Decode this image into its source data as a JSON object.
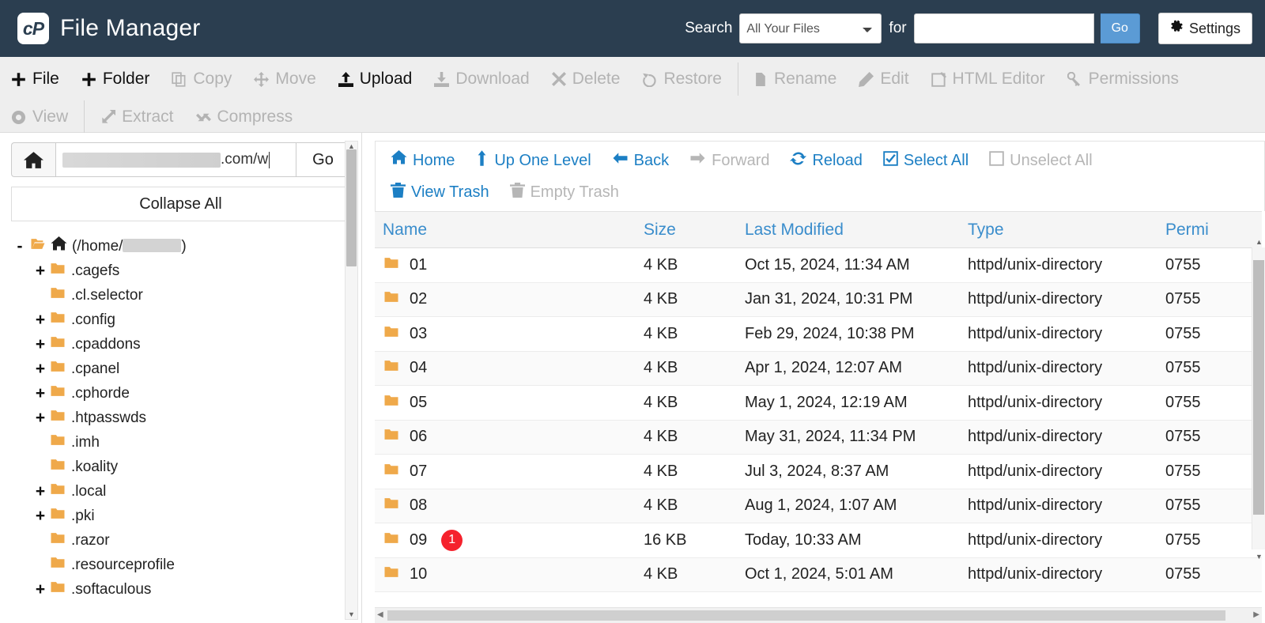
{
  "header": {
    "logo_text": "cP",
    "title": "File Manager",
    "search_label": "Search",
    "search_scope_selected": "All Your Files",
    "search_scope_options": [
      "All Your Files"
    ],
    "for_label": "for",
    "search_value": "",
    "search_placeholder": "",
    "go_label": "Go",
    "settings_label": "Settings",
    "bg_color": "#2b3e50",
    "go_button_color": "#5b9bd5"
  },
  "toolbar": {
    "row1": [
      {
        "label": "File",
        "icon": "plus-icon",
        "disabled": false
      },
      {
        "label": "Folder",
        "icon": "plus-icon",
        "disabled": false
      },
      {
        "label": "Copy",
        "icon": "copy-icon",
        "disabled": true
      },
      {
        "label": "Move",
        "icon": "move-icon",
        "disabled": true
      },
      {
        "label": "Upload",
        "icon": "upload-icon",
        "disabled": false
      },
      {
        "label": "Download",
        "icon": "download-icon",
        "disabled": true
      },
      {
        "label": "Delete",
        "icon": "x-icon",
        "disabled": true
      },
      {
        "label": "Restore",
        "icon": "restore-icon",
        "disabled": true
      },
      {
        "label": "Rename",
        "icon": "file-icon",
        "disabled": true
      },
      {
        "label": "Edit",
        "icon": "pencil-icon",
        "disabled": true
      },
      {
        "label": "HTML Editor",
        "icon": "html-editor-icon",
        "disabled": true
      },
      {
        "label": "Permissions",
        "icon": "key-icon",
        "disabled": true
      }
    ],
    "row2": [
      {
        "label": "View",
        "icon": "eye-icon",
        "disabled": true
      },
      {
        "label": "Extract",
        "icon": "extract-icon",
        "disabled": true
      },
      {
        "label": "Compress",
        "icon": "compress-icon",
        "disabled": true
      }
    ]
  },
  "sidebar": {
    "home_icon": "home-icon",
    "path_value_visible": ".com/w",
    "path_redacted": true,
    "path_go_label": "Go",
    "collapse_all_label": "Collapse All",
    "tree": [
      {
        "toggle": "-",
        "label": "(/home/",
        "label_suffix": ")",
        "redacted": true,
        "icon": "open-folder-home-icon",
        "depth": 0
      },
      {
        "toggle": "+",
        "label": ".cagefs",
        "icon": "folder-icon",
        "depth": 1
      },
      {
        "toggle": "",
        "label": ".cl.selector",
        "icon": "folder-icon",
        "depth": 1
      },
      {
        "toggle": "+",
        "label": ".config",
        "icon": "folder-icon",
        "depth": 1
      },
      {
        "toggle": "+",
        "label": ".cpaddons",
        "icon": "folder-icon",
        "depth": 1
      },
      {
        "toggle": "+",
        "label": ".cpanel",
        "icon": "folder-icon",
        "depth": 1
      },
      {
        "toggle": "+",
        "label": ".cphorde",
        "icon": "folder-icon",
        "depth": 1
      },
      {
        "toggle": "+",
        "label": ".htpasswds",
        "icon": "folder-icon",
        "depth": 1
      },
      {
        "toggle": "",
        "label": ".imh",
        "icon": "folder-icon",
        "depth": 1
      },
      {
        "toggle": "",
        "label": ".koality",
        "icon": "folder-icon",
        "depth": 1
      },
      {
        "toggle": "+",
        "label": ".local",
        "icon": "folder-icon",
        "depth": 1
      },
      {
        "toggle": "+",
        "label": ".pki",
        "icon": "folder-icon",
        "depth": 1
      },
      {
        "toggle": "",
        "label": ".razor",
        "icon": "folder-icon",
        "depth": 1
      },
      {
        "toggle": "",
        "label": ".resourceprofile",
        "icon": "folder-icon",
        "depth": 1
      },
      {
        "toggle": "+",
        "label": ".softaculous",
        "icon": "folder-icon",
        "depth": 1
      }
    ]
  },
  "navbar": {
    "row1": [
      {
        "label": "Home",
        "icon": "home-icon",
        "disabled": false
      },
      {
        "label": "Up One Level",
        "icon": "arrow-up-icon",
        "disabled": false
      },
      {
        "label": "Back",
        "icon": "arrow-left-icon",
        "disabled": false
      },
      {
        "label": "Forward",
        "icon": "arrow-right-icon",
        "disabled": true
      },
      {
        "label": "Reload",
        "icon": "reload-icon",
        "disabled": false
      },
      {
        "label": "Select All",
        "icon": "checkbox-checked-icon",
        "disabled": false
      },
      {
        "label": "Unselect All",
        "icon": "checkbox-empty-icon",
        "disabled": true
      }
    ],
    "row2": [
      {
        "label": "View Trash",
        "icon": "trash-icon",
        "disabled": false
      },
      {
        "label": "Empty Trash",
        "icon": "trash-icon",
        "disabled": true
      }
    ]
  },
  "table": {
    "columns": [
      "Name",
      "Size",
      "Last Modified",
      "Type",
      "Permi"
    ],
    "rows": [
      {
        "name": "01",
        "badge": "",
        "size": "4 KB",
        "modified": "Oct 15, 2024, 11:34 AM",
        "type": "httpd/unix-directory",
        "perms": "0755"
      },
      {
        "name": "02",
        "badge": "",
        "size": "4 KB",
        "modified": "Jan 31, 2024, 10:31 PM",
        "type": "httpd/unix-directory",
        "perms": "0755"
      },
      {
        "name": "03",
        "badge": "",
        "size": "4 KB",
        "modified": "Feb 29, 2024, 10:38 PM",
        "type": "httpd/unix-directory",
        "perms": "0755"
      },
      {
        "name": "04",
        "badge": "",
        "size": "4 KB",
        "modified": "Apr 1, 2024, 12:07 AM",
        "type": "httpd/unix-directory",
        "perms": "0755"
      },
      {
        "name": "05",
        "badge": "",
        "size": "4 KB",
        "modified": "May 1, 2024, 12:19 AM",
        "type": "httpd/unix-directory",
        "perms": "0755"
      },
      {
        "name": "06",
        "badge": "",
        "size": "4 KB",
        "modified": "May 31, 2024, 11:34 PM",
        "type": "httpd/unix-directory",
        "perms": "0755"
      },
      {
        "name": "07",
        "badge": "",
        "size": "4 KB",
        "modified": "Jul 3, 2024, 8:37 AM",
        "type": "httpd/unix-directory",
        "perms": "0755"
      },
      {
        "name": "08",
        "badge": "",
        "size": "4 KB",
        "modified": "Aug 1, 2024, 1:07 AM",
        "type": "httpd/unix-directory",
        "perms": "0755"
      },
      {
        "name": "09",
        "badge": "1",
        "size": "16 KB",
        "modified": "Today, 10:33 AM",
        "type": "httpd/unix-directory",
        "perms": "0755"
      },
      {
        "name": "10",
        "badge": "",
        "size": "4 KB",
        "modified": "Oct 1, 2024, 5:01 AM",
        "type": "httpd/unix-directory",
        "perms": "0755"
      }
    ],
    "badge_color": "#f5222d",
    "header_link_color": "#3a8dcc"
  }
}
